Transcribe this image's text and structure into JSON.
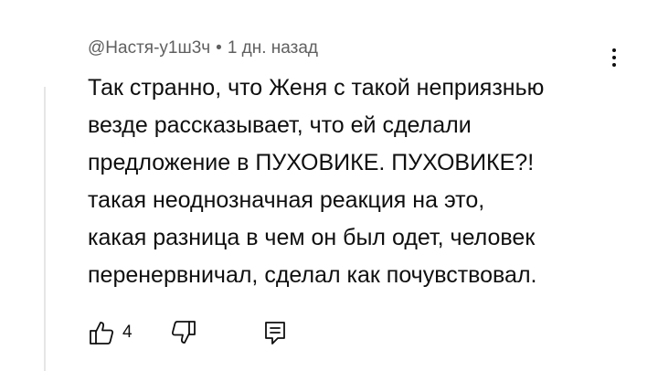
{
  "comment": {
    "author": "@Настя-у1ш3ч",
    "separator": "•",
    "time": "1 дн. назад",
    "lines": [
      "Так странно, что Женя с такой неприязнью",
      "везде рассказывает, что ей сделали",
      "предложение в ПУХОВИКЕ. ПУХОВИКЕ?!",
      "такая неоднозначная реакция на это,",
      "какая разница в чем он был одет, человек",
      "перенервничал, сделал как почувствовал."
    ]
  },
  "actions": {
    "like_count": "4",
    "like_icon": "thumbs-up-icon",
    "dislike_icon": "thumbs-down-icon",
    "reply_icon": "reply-icon"
  },
  "menu": {
    "icon": "more-vertical-icon"
  },
  "colors": {
    "text": "#0f0f0f",
    "meta": "#606060",
    "thread_line": "#e6e6e6"
  }
}
